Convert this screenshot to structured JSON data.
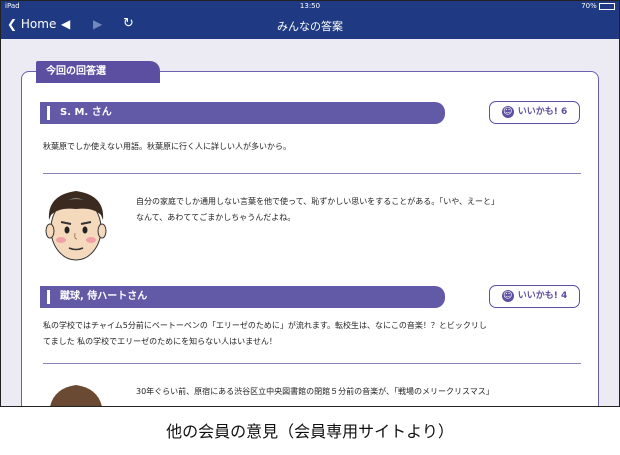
{
  "status_bar": {
    "carrier": "iPad",
    "time": "13:50",
    "battery": "70%"
  },
  "nav": {
    "home_label": "Home",
    "title": "みんなの答案"
  },
  "section": {
    "title": "今回の回答選"
  },
  "entries": [
    {
      "name": "S. M. さん",
      "like_label": "いいかも! 6",
      "answer": "秋葉原でしか使えない用語。秋葉原に行く人に詳しい人が多いから。"
    },
    {
      "name": "蹴球, 侍ハートさん",
      "like_label": "いいかも! 4",
      "answer_lines": [
        "私の学校ではチャイム5分前にベートーベンの「エリーゼのために」が流れます。転校生は、なにこの音楽！？とビックリし",
        "てました 私の学校でエリーゼのためにを知らない人はいません！"
      ]
    }
  ],
  "comments": [
    {
      "lines": [
        "自分の家庭でしか通用しない言葉を他で使って、恥ずかしい思いをすることがある。「いや、えーと」",
        "なんて、あわててごまかしちゃうんだよね。"
      ]
    },
    {
      "lines": [
        "30年ぐらい前、原宿にある渋谷区立中央図書館の閉館５分前の音楽が、「戦場のメリークリスマス」"
      ]
    }
  ],
  "caption": "他の会員の意見（会員専用サイトより）"
}
